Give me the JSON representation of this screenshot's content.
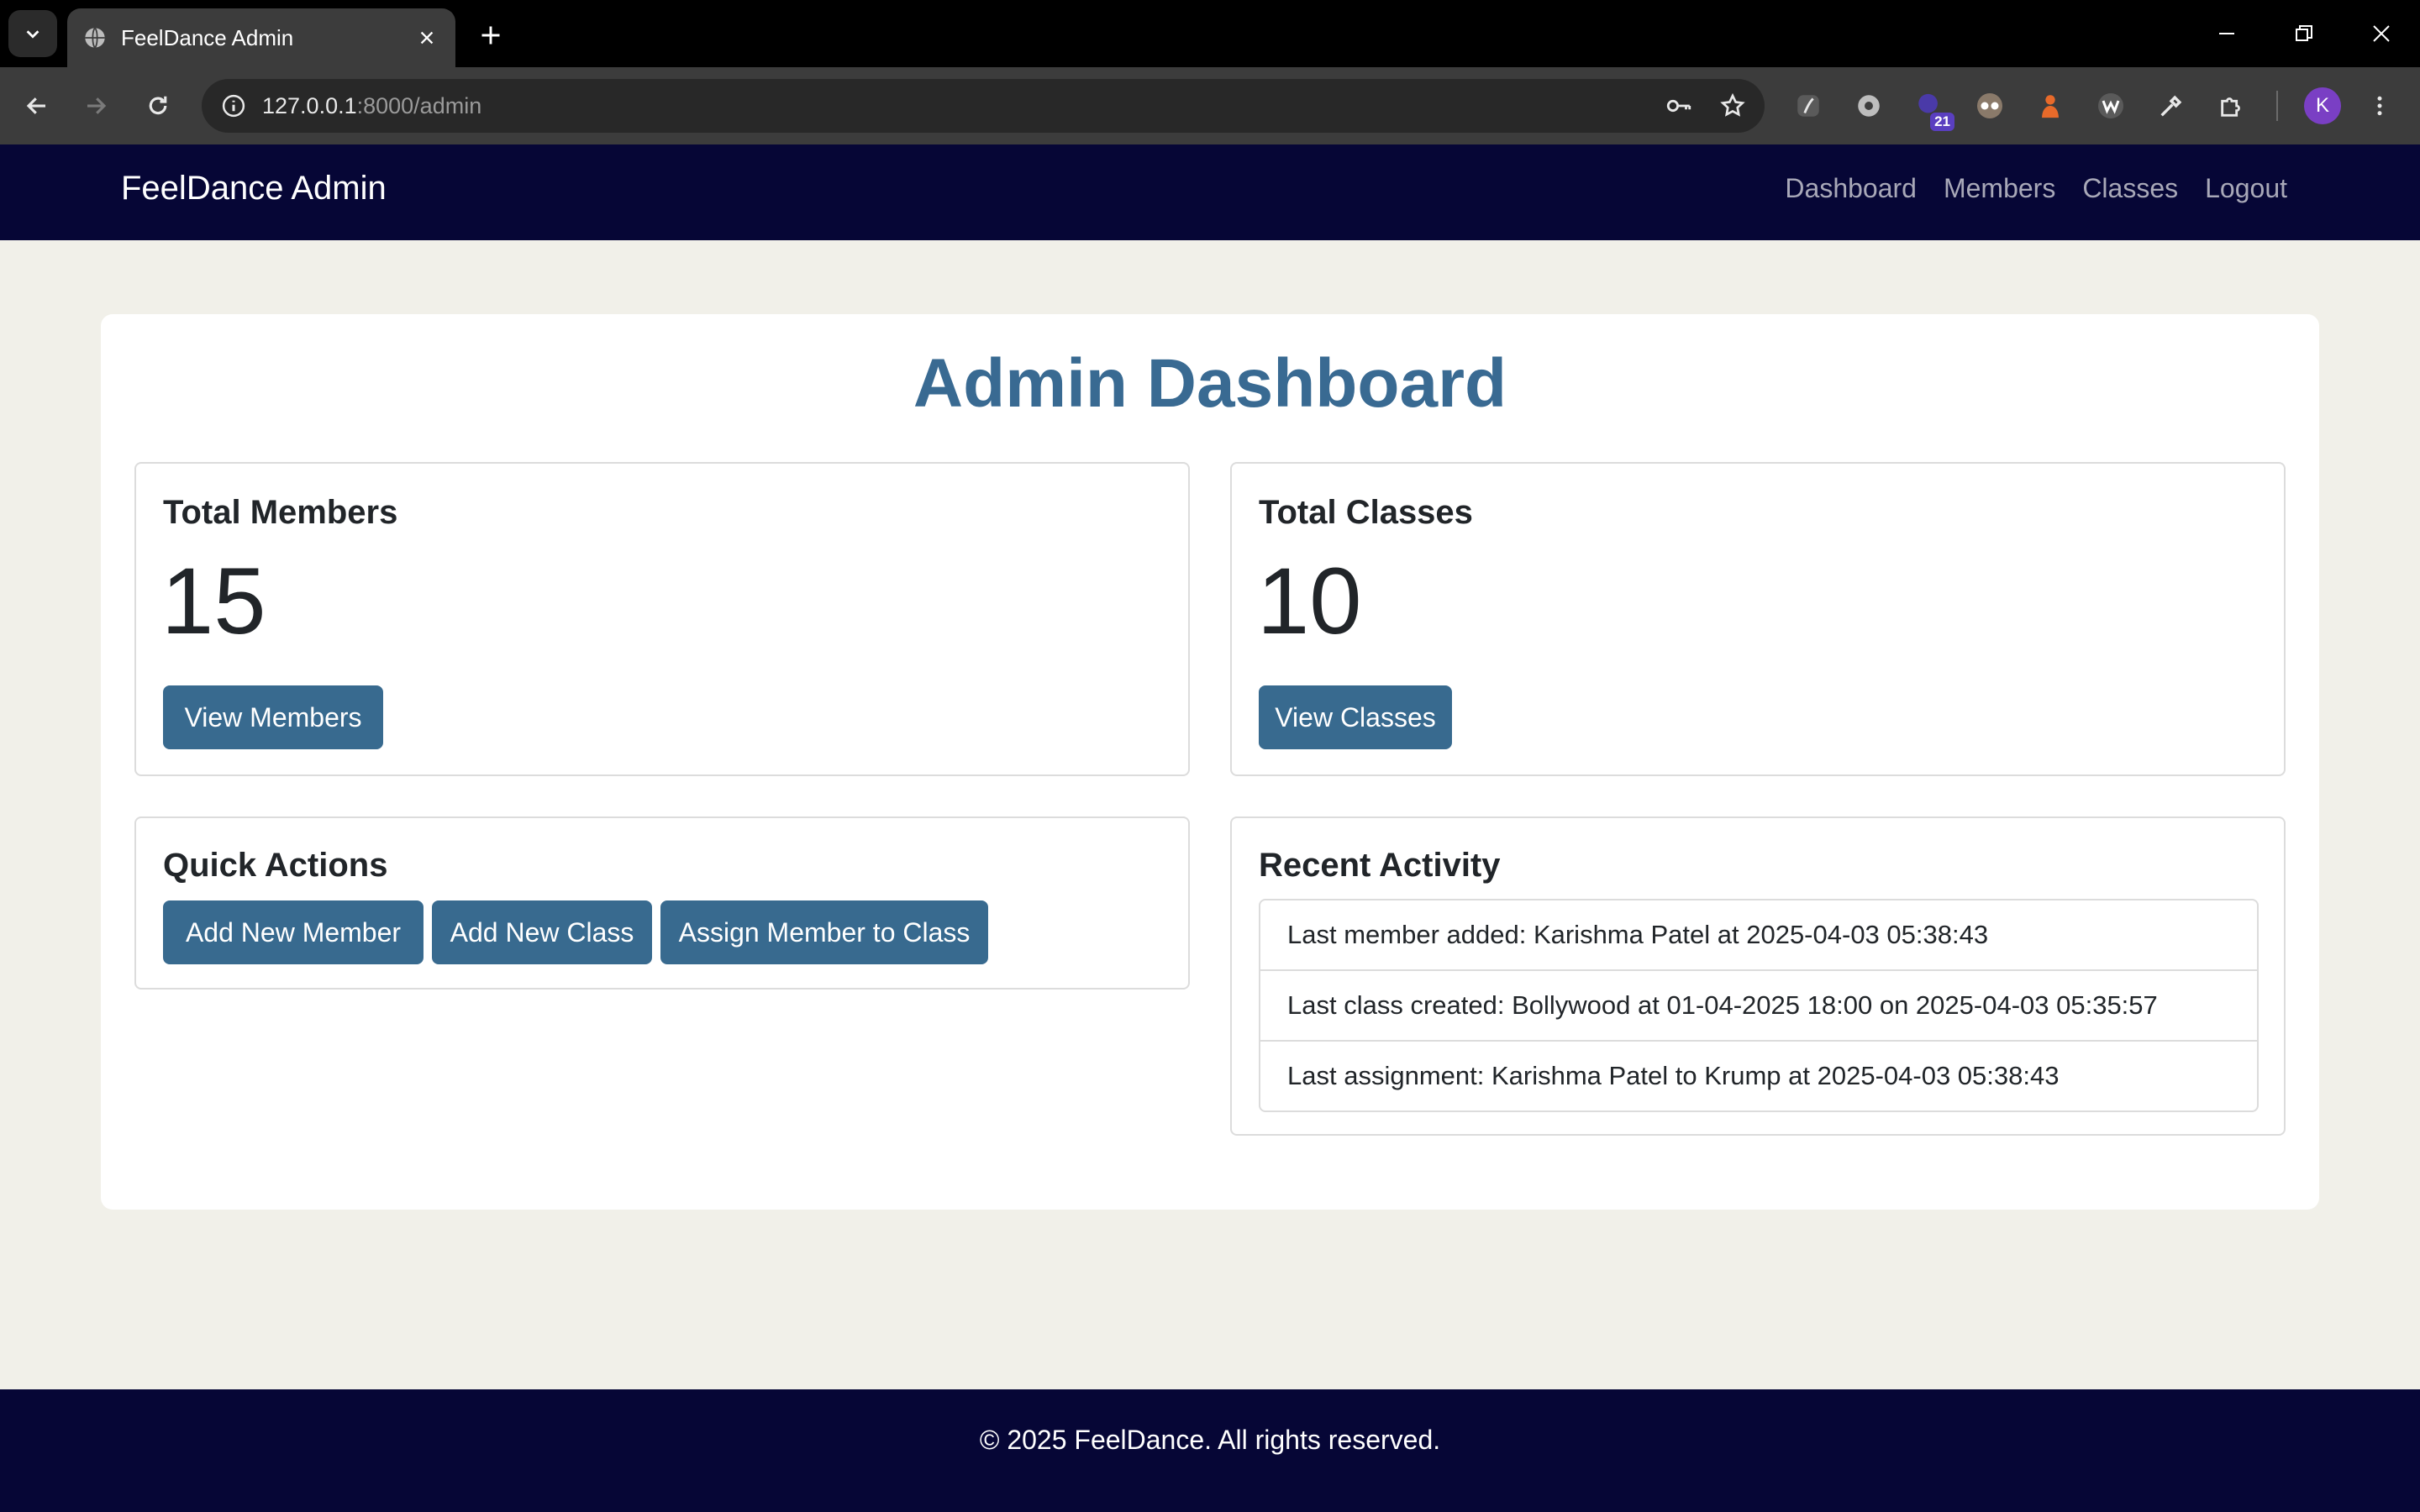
{
  "browser": {
    "tab_title": "FeelDance Admin",
    "url_host": "127.0.0.1",
    "url_path": ":8000/admin",
    "extension_badge": "21",
    "profile_initial": "K"
  },
  "site": {
    "brand": "FeelDance Admin",
    "nav": [
      "Dashboard",
      "Members",
      "Classes",
      "Logout"
    ]
  },
  "dashboard": {
    "title": "Admin Dashboard",
    "members_card": {
      "title": "Total Members",
      "count": "15",
      "button": "View Members"
    },
    "classes_card": {
      "title": "Total Classes",
      "count": "10",
      "button": "View Classes"
    },
    "quick_actions": {
      "title": "Quick Actions",
      "buttons": [
        "Add New Member",
        "Add New Class",
        "Assign Member to Class"
      ]
    },
    "recent_activity": {
      "title": "Recent Activity",
      "items": [
        "Last member added: Karishma Patel at 2025-04-03 05:38:43",
        "Last class created: Bollywood at 01-04-2025 18:00 on 2025-04-03 05:35:57",
        "Last assignment: Karishma Patel to Krump at 2025-04-03 05:38:43"
      ]
    }
  },
  "footer": {
    "text": "© 2025 FeelDance. All rights reserved."
  },
  "colors": {
    "navbar": "#060636",
    "accent": "#386a8f",
    "title": "#396a92",
    "page_bg": "#f1f0e9"
  }
}
